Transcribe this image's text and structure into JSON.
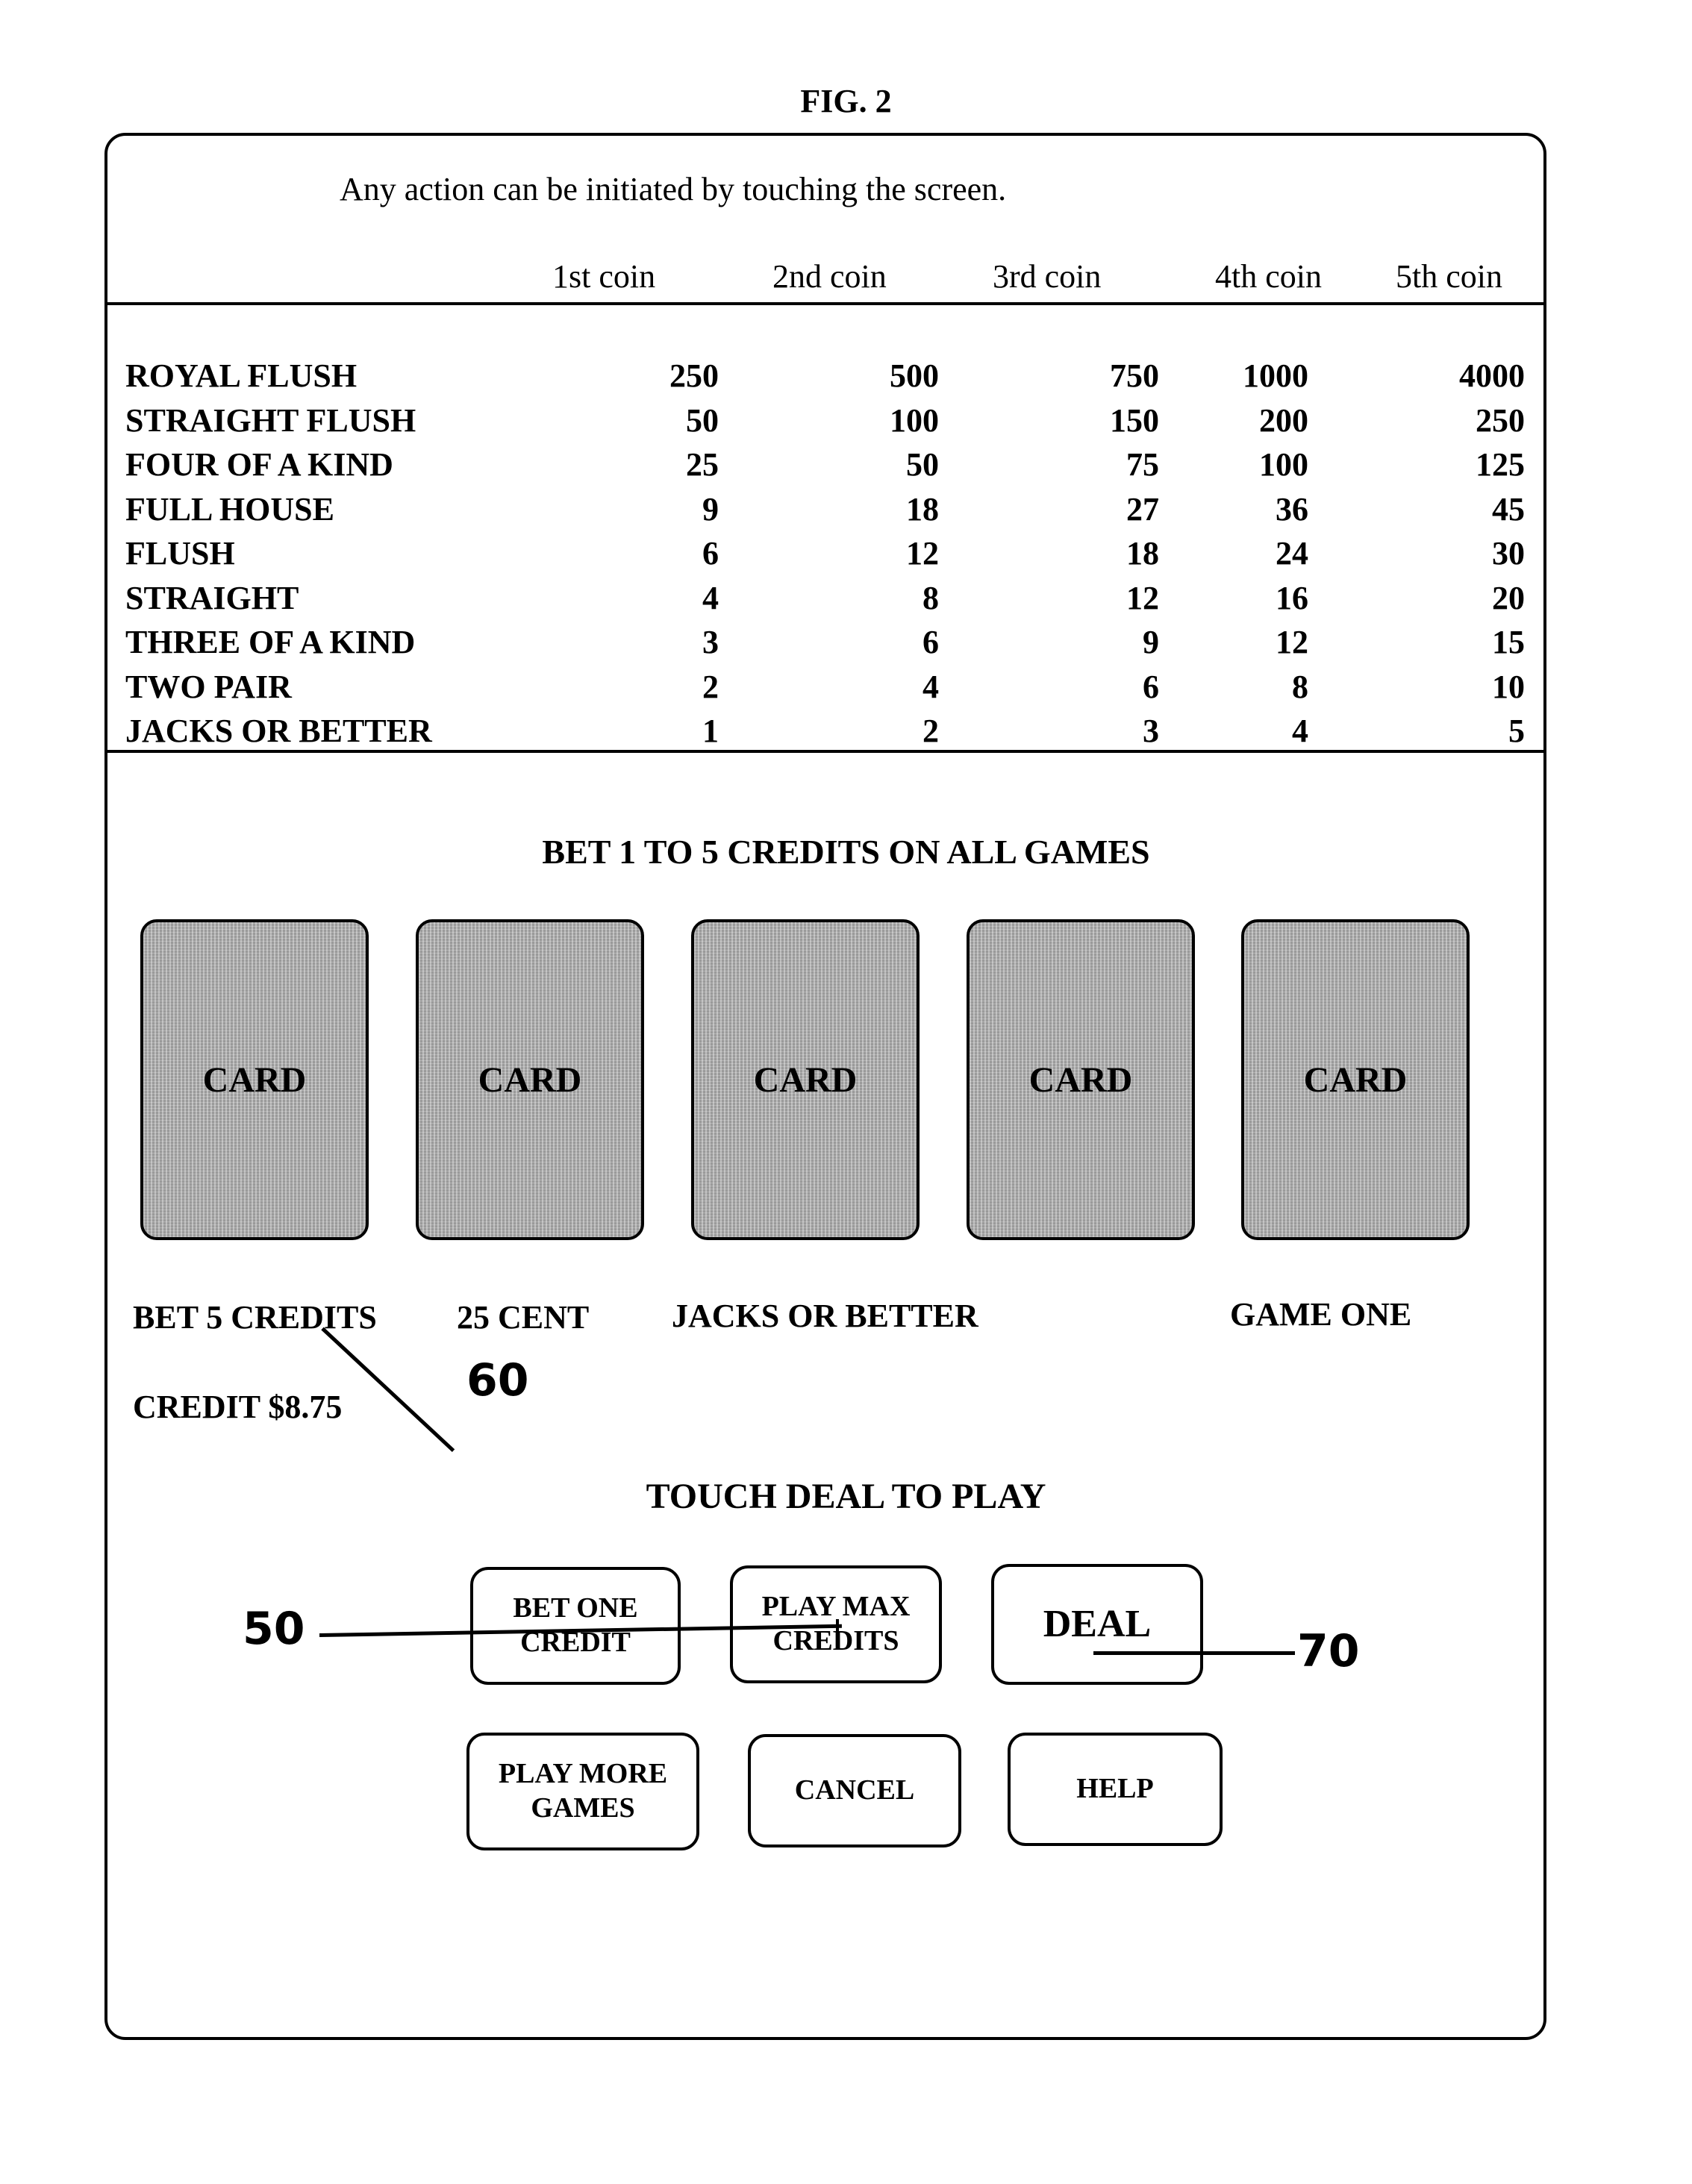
{
  "figure": {
    "title": "FIG. 2"
  },
  "screen": {
    "instruction": "Any action can be initiated by touching the screen.",
    "paytable": {
      "columns": [
        "1st coin",
        "2nd coin",
        "3rd coin",
        "4th coin",
        "5th coin"
      ],
      "rows": [
        {
          "hand": "ROYAL FLUSH",
          "payouts": [
            "250",
            "500",
            "750",
            "1000",
            "4000"
          ]
        },
        {
          "hand": "STRAIGHT FLUSH",
          "payouts": [
            "50",
            "100",
            "150",
            "200",
            "250"
          ]
        },
        {
          "hand": "FOUR OF A KIND",
          "payouts": [
            "25",
            "50",
            "75",
            "100",
            "125"
          ]
        },
        {
          "hand": "FULL HOUSE",
          "payouts": [
            "9",
            "18",
            "27",
            "36",
            "45"
          ]
        },
        {
          "hand": "FLUSH",
          "payouts": [
            "6",
            "12",
            "18",
            "24",
            "30"
          ]
        },
        {
          "hand": "STRAIGHT",
          "payouts": [
            "4",
            "8",
            "12",
            "16",
            "20"
          ]
        },
        {
          "hand": "THREE OF A KIND",
          "payouts": [
            "3",
            "6",
            "9",
            "12",
            "15"
          ]
        },
        {
          "hand": "TWO PAIR",
          "payouts": [
            "2",
            "4",
            "6",
            "8",
            "10"
          ]
        },
        {
          "hand": "JACKS OR BETTER",
          "payouts": [
            "1",
            "2",
            "3",
            "4",
            "5"
          ]
        }
      ]
    },
    "bet_banner": "BET 1 TO 5 CREDITS ON ALL GAMES",
    "cards": [
      "CARD",
      "CARD",
      "CARD",
      "CARD",
      "CARD"
    ],
    "status": {
      "bet": "BET 5 CREDITS",
      "denomination": "25 CENT",
      "game_type": "JACKS OR BETTER",
      "game_name": "GAME ONE",
      "credit": "CREDIT $8.75"
    },
    "prompt": "TOUCH  DEAL  TO PLAY",
    "buttons": {
      "bet_one_credit": "BET ONE CREDIT",
      "play_max_credits": "PLAY MAX CREDITS",
      "deal": "DEAL",
      "play_more_games": "PLAY MORE GAMES",
      "cancel": "CANCEL",
      "help": "HELP"
    }
  },
  "reference_numerals": {
    "credit_meter": "60",
    "bet_buttons": "50",
    "deal_button": "70"
  }
}
